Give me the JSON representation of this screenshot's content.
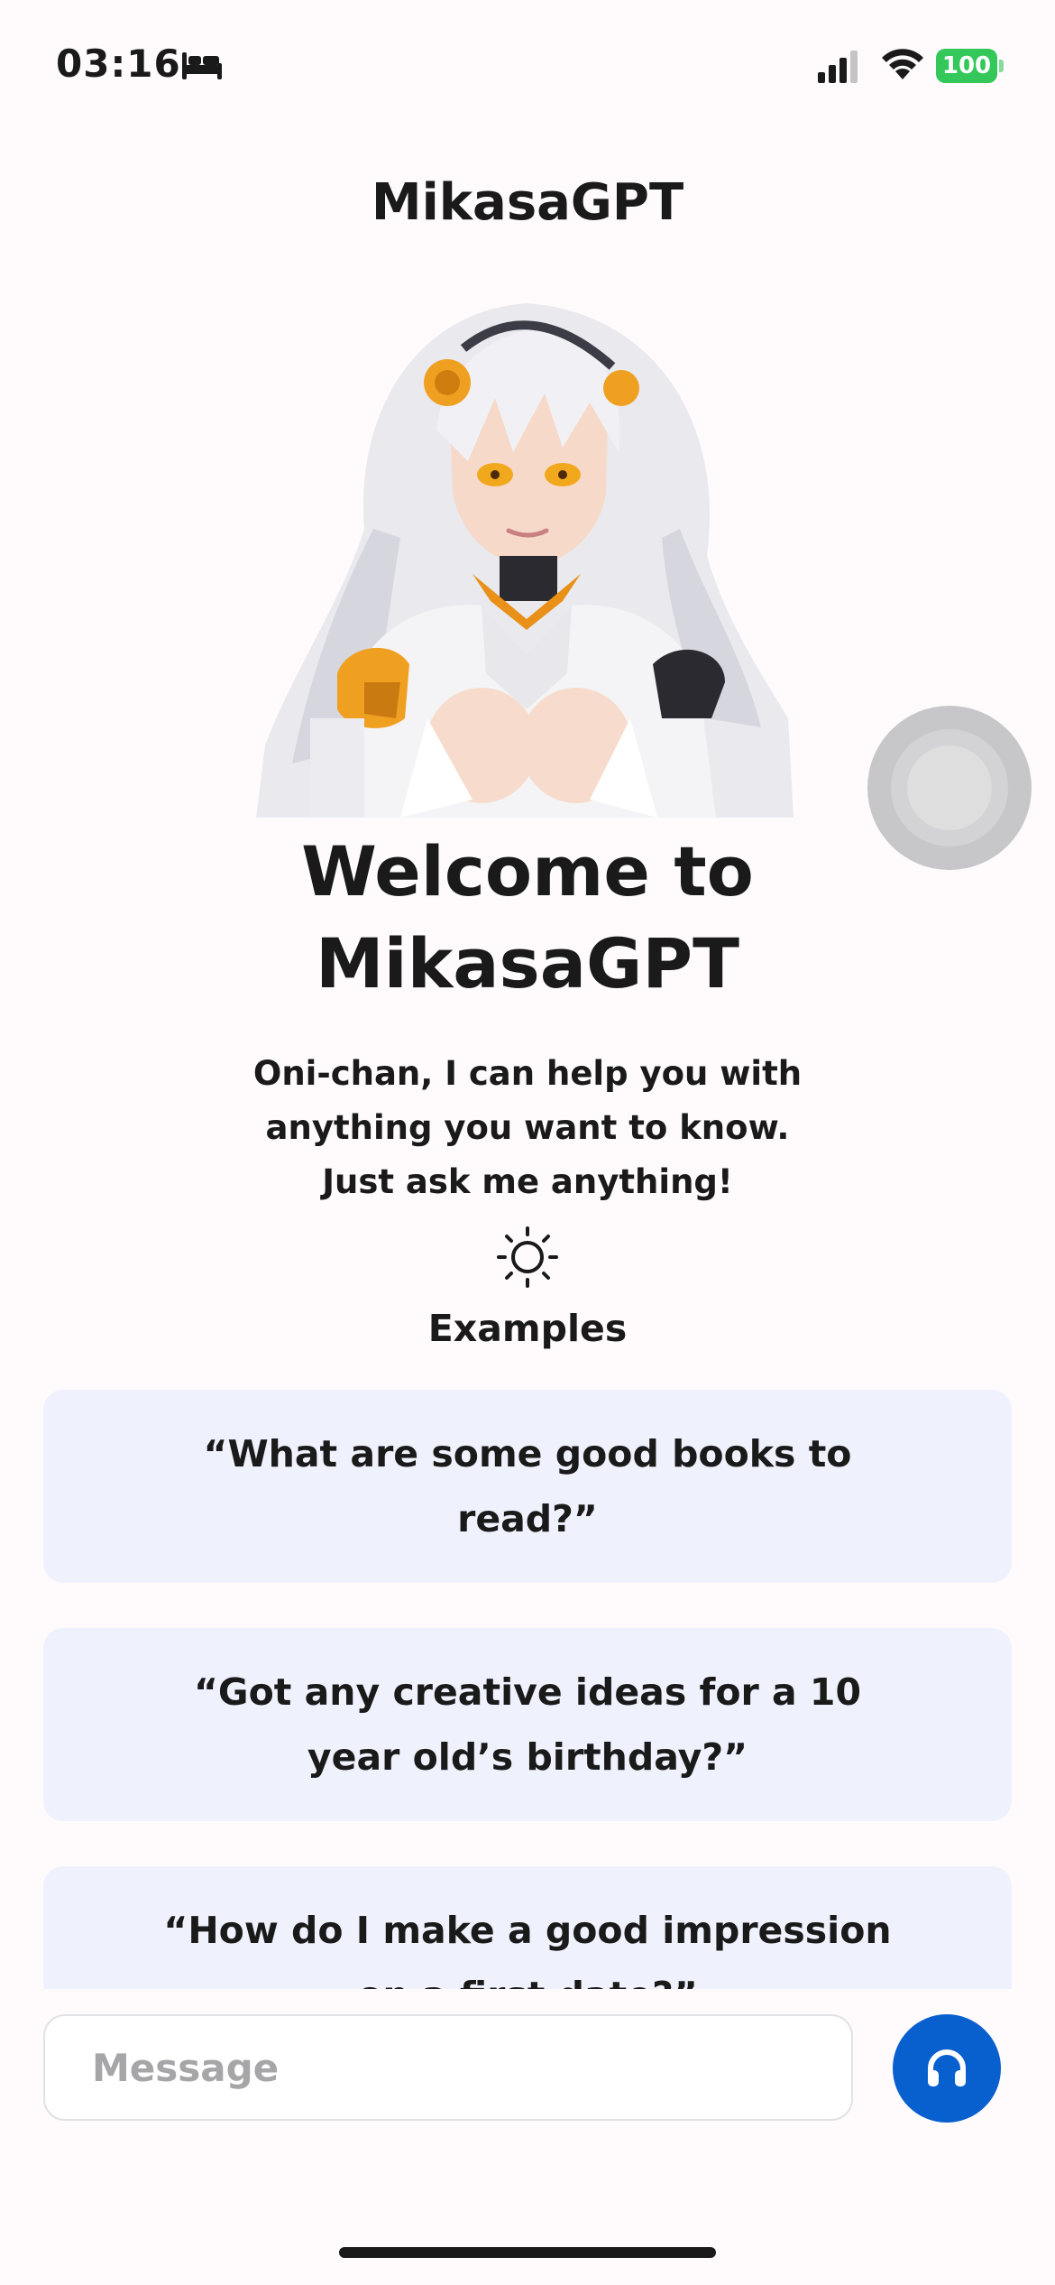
{
  "status_bar": {
    "time": "03:16",
    "battery": "100",
    "icons": [
      "bed-icon",
      "signal-icon",
      "wifi-icon",
      "battery-icon"
    ],
    "battery_color": "#34c759"
  },
  "header": {
    "title": "MikasaGPT"
  },
  "hero": {
    "image": "avatar-illustration"
  },
  "welcome": {
    "title_line1": "Welcome to",
    "title_line2": "MikasaGPT",
    "subtitle": "Oni-chan, I can help you with anything you want to know. Just ask me anything!"
  },
  "examples": {
    "icon": "sun-icon",
    "label": "Examples",
    "items": [
      "“What are some good books to read?”",
      "“Got any creative ideas for a 10 year old’s birthday?”",
      "“How do I make a good impression on a first date?”"
    ]
  },
  "composer": {
    "placeholder": "Message",
    "voice_icon": "headphones-icon",
    "accent_color": "#0860cf"
  }
}
